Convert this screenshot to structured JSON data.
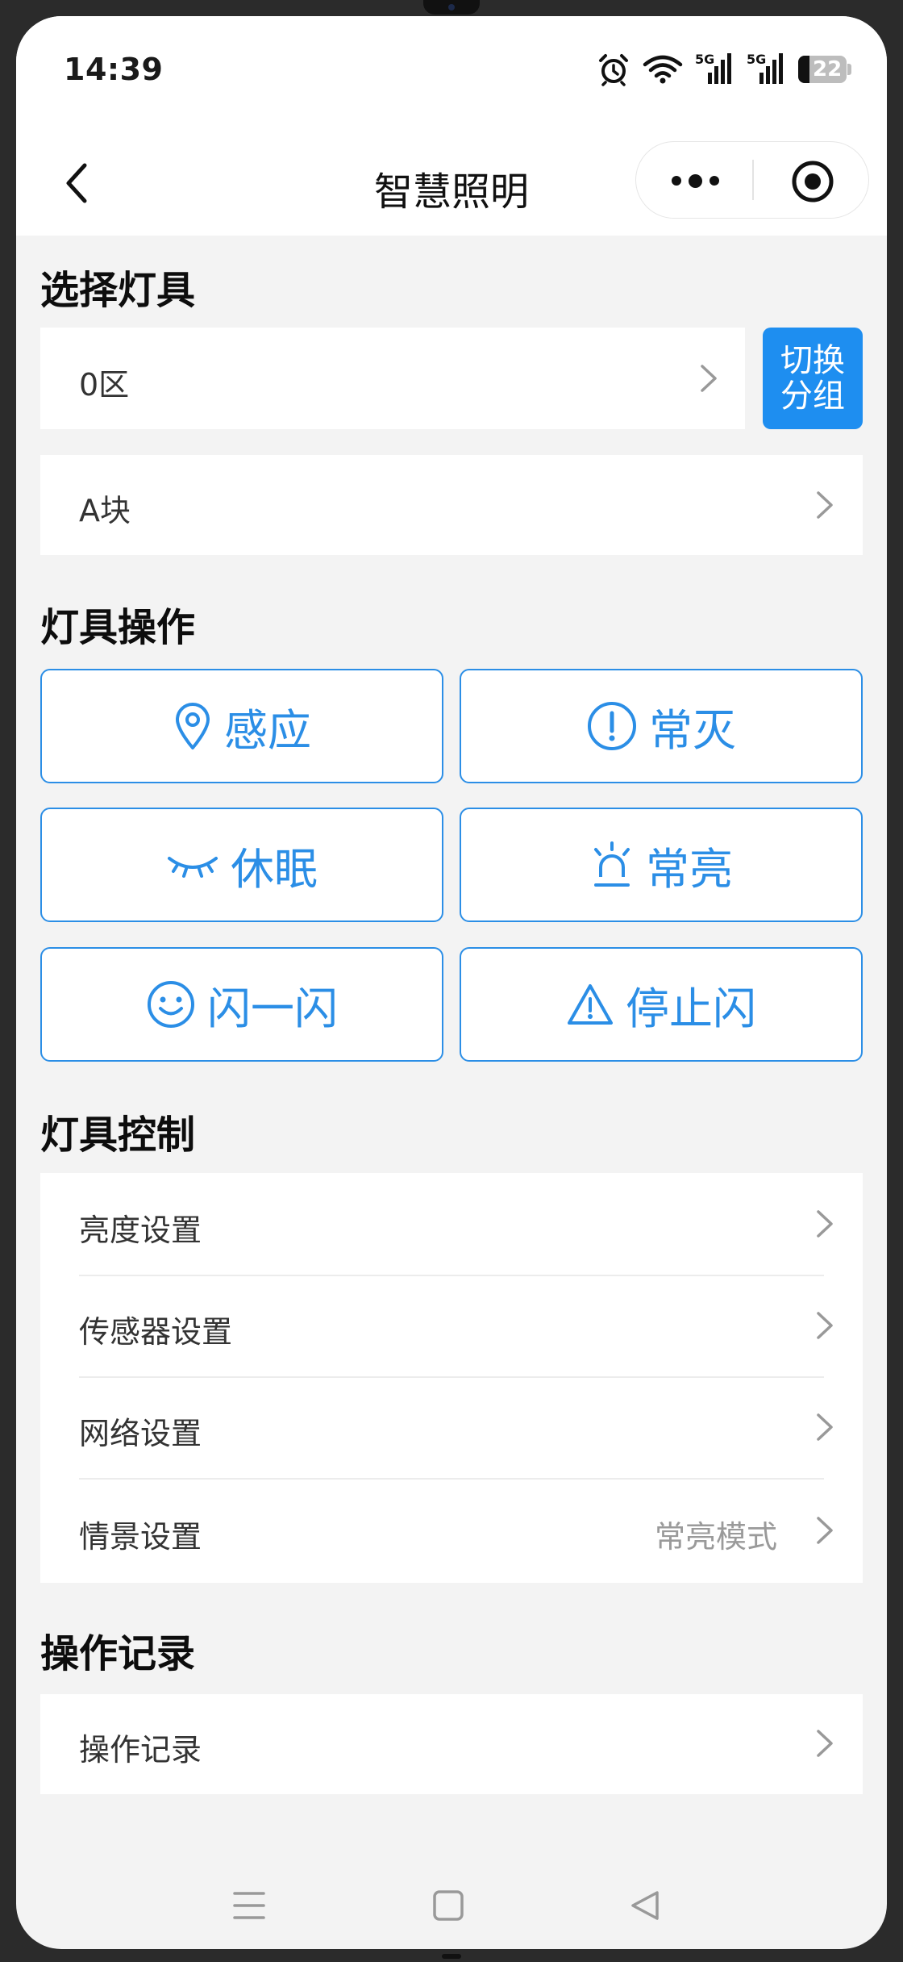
{
  "status_bar": {
    "time": "14:39",
    "battery": "22",
    "sim1": "5G",
    "sim2": "5G",
    "icons": [
      "alarm-icon",
      "wifi-icon",
      "signal-icon",
      "signal-icon",
      "battery-icon"
    ]
  },
  "nav": {
    "title": "智慧照明",
    "back_icon": "chevron-left-icon",
    "more_icon": "more-icon",
    "close_icon": "target-icon"
  },
  "select_section": {
    "title": "选择灯具",
    "zone": "0区",
    "block": "A块",
    "switch_group": [
      "切换",
      "分组"
    ]
  },
  "operation_section": {
    "title": "灯具操作",
    "buttons": [
      {
        "label": "感应",
        "icon": "location-icon"
      },
      {
        "label": "常灭",
        "icon": "alert-circle-icon"
      },
      {
        "label": "休眠",
        "icon": "closed-eye-icon"
      },
      {
        "label": "常亮",
        "icon": "light-alarm-icon"
      },
      {
        "label": "闪一闪",
        "icon": "smile-icon"
      },
      {
        "label": "停止闪",
        "icon": "warning-icon"
      }
    ]
  },
  "control_section": {
    "title": "灯具控制",
    "items": [
      {
        "label": "亮度设置",
        "value": ""
      },
      {
        "label": "传感器设置",
        "value": ""
      },
      {
        "label": "网络设置",
        "value": ""
      },
      {
        "label": "情景设置",
        "value": "常亮模式"
      }
    ]
  },
  "record_section": {
    "title": "操作记录",
    "item": "操作记录"
  },
  "colors": {
    "accent": "#2b8ee6",
    "button_fill": "#1e8ef0",
    "background": "#f3f3f3"
  }
}
